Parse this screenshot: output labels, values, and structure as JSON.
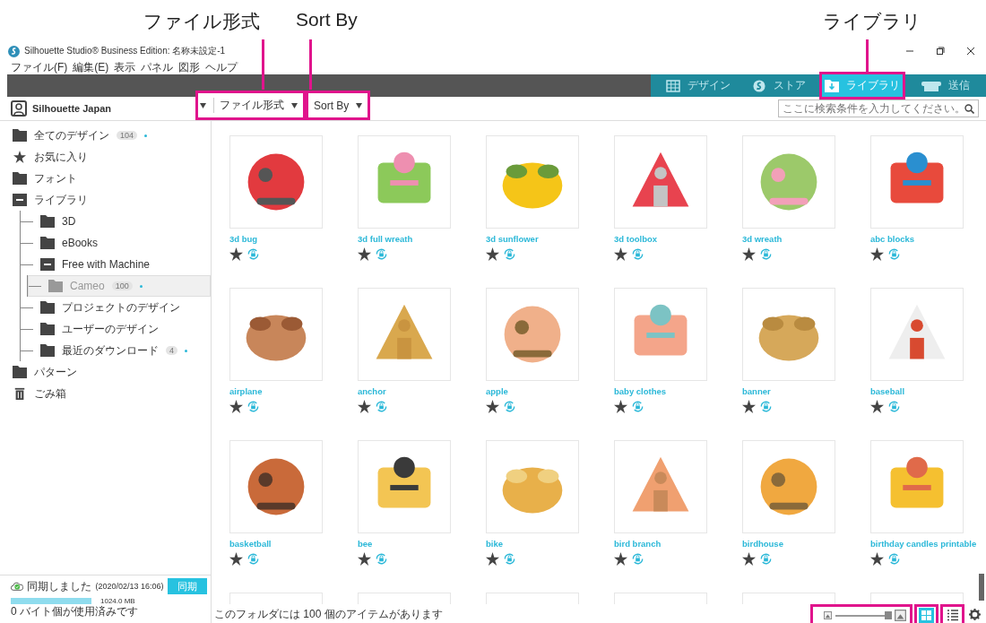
{
  "annotations": [
    {
      "label": "ファイル形式"
    },
    {
      "label": "Sort By"
    },
    {
      "label": "ライブラリ"
    }
  ],
  "window": {
    "title": "Silhouette Studio® Business Edition: 名称未設定-1"
  },
  "menu": [
    "ファイル(F)",
    "編集(E)",
    "表示",
    "パネル",
    "図形",
    "ヘルプ"
  ],
  "nav_tabs": [
    {
      "label": "デザイン",
      "kind": "design",
      "selected": false
    },
    {
      "label": "ストア",
      "kind": "store",
      "selected": false
    },
    {
      "label": "ライブラリ",
      "kind": "library",
      "selected": true
    },
    {
      "label": "送信",
      "kind": "send",
      "selected": false
    }
  ],
  "account": {
    "name": "Silhouette Japan"
  },
  "toolbar": {
    "file_format": "ファイル形式",
    "sort_by": "Sort By",
    "search": {
      "placeholder": "ここに検索条件を入力してください。"
    }
  },
  "sidebar": {
    "items": [
      {
        "label": "全てのデザイン",
        "kind": "folder",
        "count": "104",
        "selected": false
      },
      {
        "label": "お気に入り",
        "kind": "star",
        "selected": false
      },
      {
        "label": "フォント",
        "kind": "folder",
        "selected": false
      },
      {
        "label": "ライブラリ",
        "kind": "folder",
        "expanded": true,
        "selected": false,
        "children": [
          {
            "label": "3D",
            "kind": "folder",
            "selected": false
          },
          {
            "label": "eBooks",
            "kind": "folder",
            "selected": false
          },
          {
            "label": "Free with Machine",
            "kind": "folder",
            "expanded": true,
            "selected": false,
            "children": [
              {
                "label": "Cameo",
                "kind": "folder",
                "count": "100",
                "selected": true
              }
            ]
          },
          {
            "label": "プロジェクトのデザイン",
            "kind": "folder",
            "selected": false
          },
          {
            "label": "ユーザーのデザイン",
            "kind": "folder",
            "selected": false
          },
          {
            "label": "最近のダウンロード",
            "kind": "folder",
            "count": "4",
            "selected": false
          }
        ]
      },
      {
        "label": "パターン",
        "kind": "folder",
        "selected": false
      },
      {
        "label": "ごみ箱",
        "kind": "trash",
        "selected": false
      }
    ]
  },
  "sync": {
    "status": "同期しました",
    "time": "(2020/02/13 16:06)",
    "button": "同期",
    "storage": {
      "level": 1,
      "reading": "1024.0 MB"
    },
    "usage": "0 バイト個が使用済みです"
  },
  "grid": {
    "items": [
      {
        "name": "3d bug"
      },
      {
        "name": "3d full wreath"
      },
      {
        "name": "3d sunflower"
      },
      {
        "name": "3d toolbox"
      },
      {
        "name": "3d wreath"
      },
      {
        "name": "abc blocks"
      },
      {
        "name": "airplane"
      },
      {
        "name": "anchor"
      },
      {
        "name": "apple"
      },
      {
        "name": "baby clothes"
      },
      {
        "name": "banner"
      },
      {
        "name": "baseball"
      },
      {
        "name": "basketball"
      },
      {
        "name": "bee"
      },
      {
        "name": "bike"
      },
      {
        "name": "bird branch"
      },
      {
        "name": "birdhouse"
      },
      {
        "name": "birthday candles printable"
      },
      {
        "kind": "picture"
      },
      {
        "kind": "picture"
      },
      {
        "kind": "picture"
      },
      {
        "kind": "picture"
      },
      {
        "kind": "picture"
      },
      {
        "kind": "picture"
      }
    ]
  },
  "status_bar": {
    "text": "このフォルダには 100 個のアイテムがあります"
  },
  "view": {
    "zoom": {
      "level": 0.95
    },
    "modes": [
      {
        "kind": "grid",
        "selected": true
      },
      {
        "kind": "list",
        "selected": false
      }
    ]
  }
}
